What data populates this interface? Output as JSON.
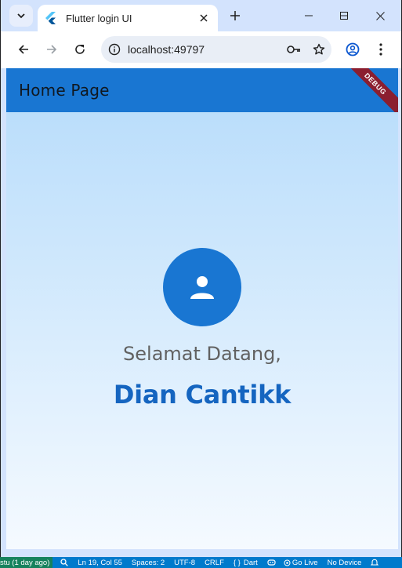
{
  "browser": {
    "tab_title": "Flutter login UI",
    "url": "localhost:49797"
  },
  "app": {
    "appbar_title": "Home Page",
    "debug_banner": "DEBUG",
    "greeting": "Selamat Datang,",
    "username": "Dian Cantikk",
    "colors": {
      "primary": "#1976d2",
      "username": "#1565c0",
      "greeting": "#616161",
      "gradient_top": "#bbdefb",
      "gradient_bottom": "#f5faff"
    }
  },
  "icons": {
    "avatar": "person-icon"
  },
  "statusbar": {
    "git": "stu (1 day ago)",
    "position": "Ln 19, Col 55",
    "spaces": "Spaces: 2",
    "encoding": "UTF-8",
    "eol": "CRLF",
    "language": "Dart",
    "golive": "Go Live",
    "device": "No Device"
  }
}
